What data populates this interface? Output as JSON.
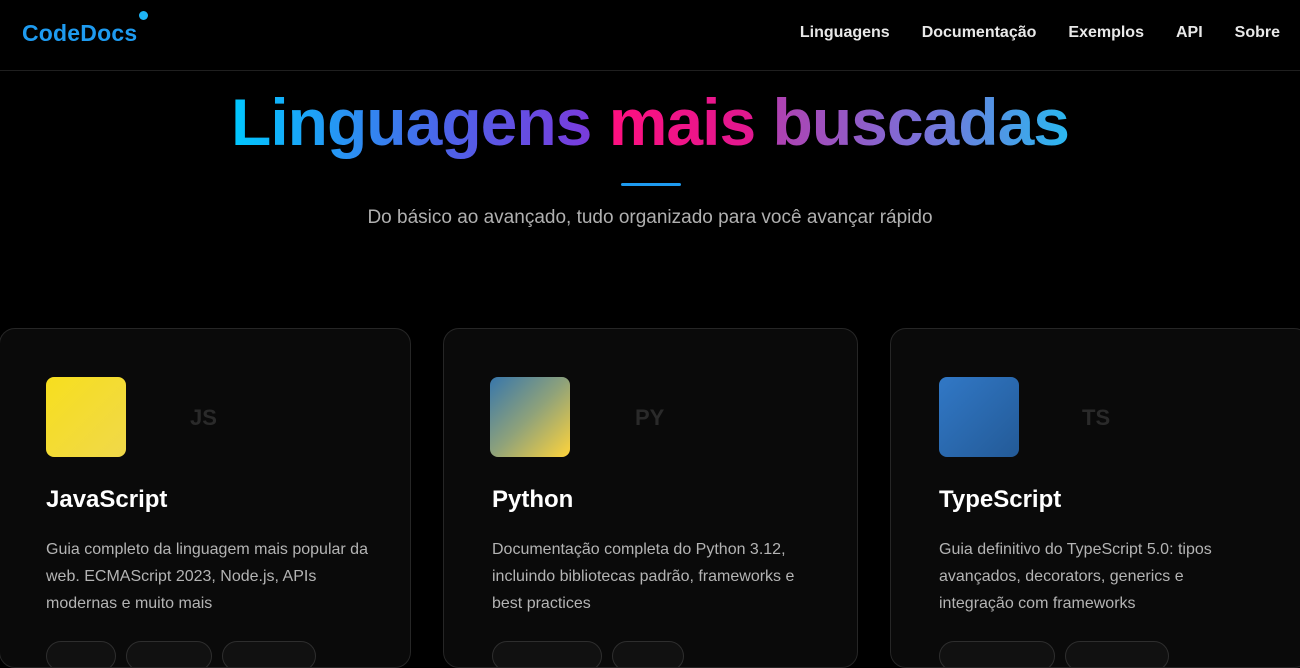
{
  "brand": {
    "name": "CodeDocs"
  },
  "nav": {
    "links": [
      "Linguagens",
      "Documentação",
      "Exemplos",
      "API",
      "Sobre"
    ]
  },
  "hero": {
    "title_part1": "Linguagens",
    "title_part2": "mais",
    "title_part3": "buscadas",
    "subtitle": "Do básico ao avançado, tudo organizado para você avançar rápido"
  },
  "cards": [
    {
      "code": "JS",
      "title": "JavaScript",
      "description": "Guia completo da linguagem mais popular da web. ECMAScript 2023, Node.js, APIs modernas e muito mais",
      "icon_colors": [
        "#f7df1e",
        "#f0d84a"
      ]
    },
    {
      "code": "PY",
      "title": "Python",
      "description": "Documentação completa do Python 3.12, incluindo bibliotecas padrão, frameworks e best practices",
      "icon_colors": [
        "#3776ab",
        "#ffd43b"
      ]
    },
    {
      "code": "TS",
      "title": "TypeScript",
      "description": "Guia definitivo do TypeScript 5.0: tipos avançados, decorators, generics e integração com frameworks",
      "icon_colors": [
        "#3178c6",
        "#235a97"
      ]
    }
  ],
  "colors": {
    "accent": "#1e9bf0",
    "background": "#000000"
  }
}
